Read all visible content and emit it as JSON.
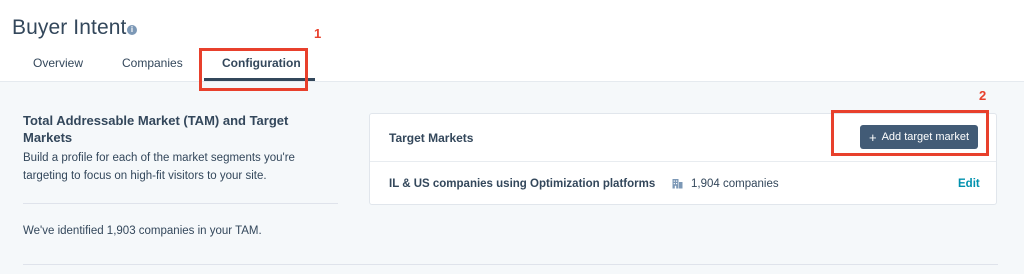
{
  "header": {
    "title": "Buyer Intent",
    "info_icon": "info-circle-icon",
    "tabs": [
      {
        "label": "Overview",
        "active": false
      },
      {
        "label": "Companies",
        "active": false
      },
      {
        "label": "Configuration",
        "active": true
      }
    ]
  },
  "annotations": {
    "marker_1": "1",
    "marker_2": "2",
    "color": "#e8402c"
  },
  "tam_section": {
    "title": "Total Addressable Market (TAM) and Target Markets",
    "description": "Build a profile for each of the market segments you're targeting to focus on high-fit visitors to your site.",
    "note": "We've identified 1,903 companies in your TAM."
  },
  "target_markets": {
    "title": "Target Markets",
    "add_button_label": "Add target market",
    "add_icon": "plus-icon",
    "rows": [
      {
        "name": "IL & US companies using Optimization platforms",
        "count_icon": "building-icon",
        "count": "1,904 companies",
        "action": "Edit"
      }
    ]
  },
  "colors": {
    "primary_text": "#33475b",
    "button_bg": "#425b76",
    "link": "#0091ae",
    "page_bg": "#f5f8fa"
  }
}
